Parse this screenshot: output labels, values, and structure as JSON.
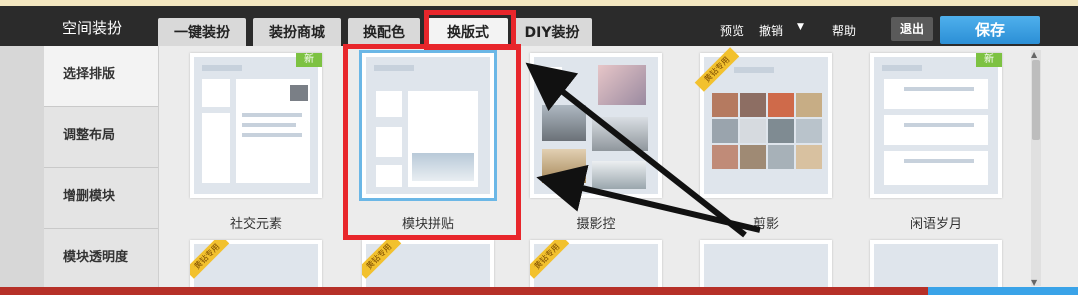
{
  "header": {
    "title": "空间装扮",
    "tabs": [
      {
        "label": "一键装扮"
      },
      {
        "label": "装扮商城"
      },
      {
        "label": "换配色"
      },
      {
        "label": "换版式"
      },
      {
        "label": "DIY装扮"
      }
    ],
    "preview_label": "预览",
    "undo_label": "撤销",
    "help_label": "帮助",
    "exit_label": "退出",
    "save_label": "保存"
  },
  "sidebar": {
    "items": [
      {
        "label": "选择排版"
      },
      {
        "label": "调整布局"
      },
      {
        "label": "增删模块"
      },
      {
        "label": "模块透明度"
      }
    ]
  },
  "layouts": [
    {
      "label": "社交元素",
      "badge": "新"
    },
    {
      "label": "模块拼贴",
      "badge": ""
    },
    {
      "label": "摄影控",
      "badge": ""
    },
    {
      "label": "剪影",
      "badge": "黄钻专用"
    },
    {
      "label": "闲语岁月",
      "badge": "新"
    }
  ],
  "lower_badges": [
    "黄钻专用",
    "黄钻专用",
    "黄钻专用"
  ],
  "colors": {
    "topbar": "#2b2b2b",
    "save": "#2b8fd6",
    "highlight": "#e8262b"
  }
}
